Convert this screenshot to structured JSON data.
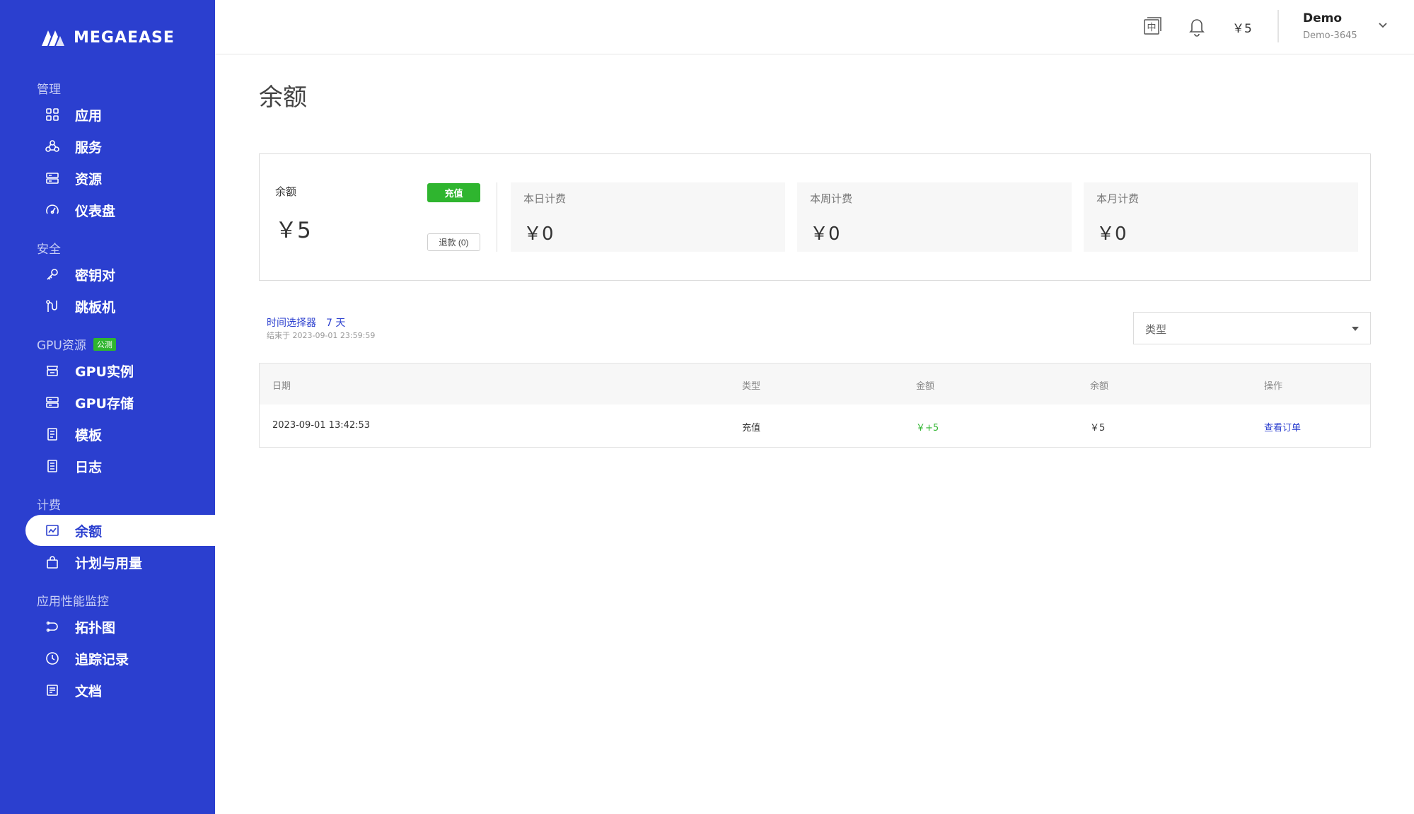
{
  "brand": {
    "name": "MEGAEASE",
    "logo_icon": "megaease-logo-icon"
  },
  "sidebar": {
    "sections": [
      {
        "title": "管理",
        "items": [
          {
            "label": "应用",
            "icon": "apps-grid-icon"
          },
          {
            "label": "服务",
            "icon": "services-icon"
          },
          {
            "label": "资源",
            "icon": "server-icon"
          },
          {
            "label": "仪表盘",
            "icon": "gauge-icon"
          }
        ]
      },
      {
        "title": "安全",
        "items": [
          {
            "label": "密钥对",
            "icon": "key-icon"
          },
          {
            "label": "跳板机",
            "icon": "jump-host-icon"
          }
        ]
      },
      {
        "title": "GPU资源",
        "badge": "公测",
        "items": [
          {
            "label": "GPU实例",
            "icon": "gpu-instance-icon"
          },
          {
            "label": "GPU存储",
            "icon": "storage-icon"
          },
          {
            "label": "模板",
            "icon": "template-icon"
          },
          {
            "label": "日志",
            "icon": "log-icon"
          }
        ]
      },
      {
        "title": "计费",
        "items": [
          {
            "label": "余额",
            "icon": "chart-icon",
            "active": true
          },
          {
            "label": "计划与用量",
            "icon": "bag-icon"
          }
        ]
      },
      {
        "title": "应用性能监控",
        "items": [
          {
            "label": "拓扑图",
            "icon": "topology-icon"
          },
          {
            "label": "追踪记录",
            "icon": "clock-icon"
          },
          {
            "label": "文档",
            "icon": "document-icon"
          }
        ]
      }
    ]
  },
  "header": {
    "lang_icon": "language-zh-icon",
    "lang_glyph": "中",
    "bell_icon": "bell-icon",
    "balance": "￥5",
    "user_name": "Demo",
    "user_sub": "Demo-3645"
  },
  "page": {
    "title": "余额"
  },
  "balance_card": {
    "label": "余额",
    "value": "￥5",
    "recharge_label": "充值",
    "refund_label": "退款 (0)",
    "stats": [
      {
        "label": "本日计费",
        "value": "￥0"
      },
      {
        "label": "本周计费",
        "value": "￥0"
      },
      {
        "label": "本月计费",
        "value": "￥0"
      }
    ]
  },
  "filter": {
    "time_picker_label": "时间选择器",
    "time_range": "7 天",
    "end_text": "结束于 2023-09-01 23:59:59",
    "type_placeholder": "类型"
  },
  "table": {
    "columns": [
      "日期",
      "类型",
      "金额",
      "余额",
      "操作"
    ],
    "rows": [
      {
        "date": "2023-09-01 13:42:53",
        "type": "充值",
        "amount": "￥+5",
        "balance": "￥5",
        "action": "查看订单"
      }
    ]
  },
  "colors": {
    "sidebar_bg": "#2b3fcf",
    "accent_green": "#2fb52f",
    "link_blue": "#2b3fcf"
  }
}
